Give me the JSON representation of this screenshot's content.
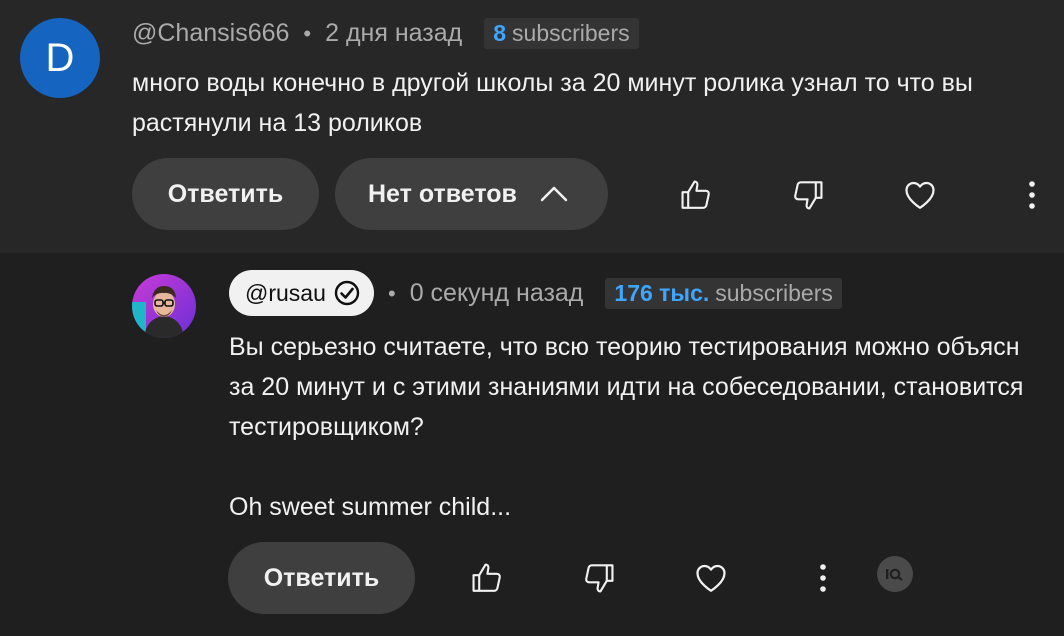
{
  "comment": {
    "avatar_letter": "D",
    "avatar_color": "#1565c0",
    "handle": "@Chansis666",
    "separator": "•",
    "time": "2 дня назад",
    "subs_count": "8",
    "subs_label": "subscribers",
    "text_line1": "много воды конечно в другой школы за 20 минут ролика узнал то что вы",
    "text_line2": "растянули на 13 роликов",
    "reply_label": "Ответить",
    "replies_label": "Нет ответов"
  },
  "reply": {
    "handle": "@rusau",
    "separator": "•",
    "time": "0 секунд назад",
    "subs_count": "176 тыс.",
    "subs_label": "subscribers",
    "text_line1": "Вы серьезно считаете, что всю теорию тестирования можно объясн",
    "text_line2": "за 20 минут и с этими знаниями идти на собеседовании, становится",
    "text_line3": "тестировщиком?",
    "text_line4": "Oh sweet summer child...",
    "reply_label": "Ответить"
  },
  "icons": {
    "like": "thumbs-up-icon",
    "dislike": "thumbs-down-icon",
    "heart": "heart-icon",
    "more": "more-vertical-icon",
    "verified": "verified-icon",
    "chevron": "chevron-up-icon",
    "extension": "extension-badge-icon"
  },
  "colors": {
    "accent": "#3ea6ff",
    "background": "#1f1f1f",
    "highlight_bg": "#272727"
  }
}
